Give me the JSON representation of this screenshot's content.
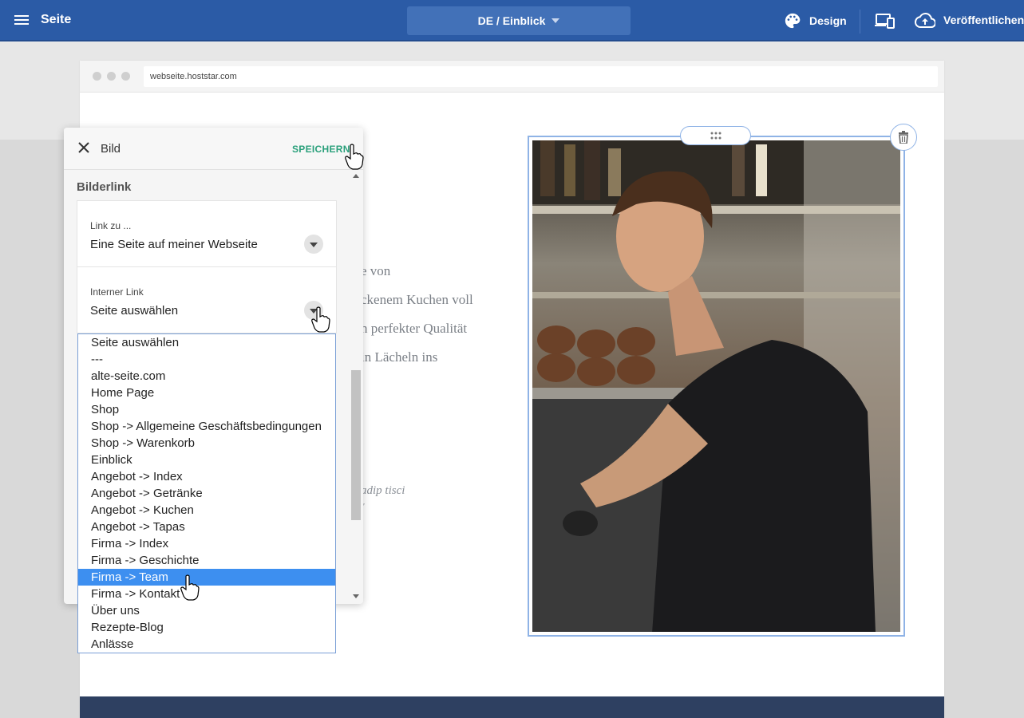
{
  "topbar": {
    "site_label": "Seite",
    "page_selector": "DE / Einblick",
    "design_label": "Design",
    "publish_label": "Veröffentlichen"
  },
  "browser": {
    "url": "webseite.hoststar.com"
  },
  "content": {
    "line1": "e von",
    "line2": "ckenem Kuchen voll",
    "line3": "n perfekter Qualität",
    "line4": "in Lächeln ins",
    "quote1": "adip tisci",
    "quote2": "\""
  },
  "panel": {
    "title": "Bild",
    "save_label": "SPEICHERN",
    "section_title": "Bilderlink",
    "link_field": {
      "label": "Link zu ...",
      "value": "Eine Seite auf meiner Webseite"
    },
    "internal_field": {
      "label": "Interner Link",
      "value": "Seite auswählen"
    }
  },
  "dropdown": {
    "options": [
      "Seite auswählen",
      "---",
      "alte-seite.com",
      "Home Page",
      "Shop",
      "Shop -> Allgemeine Geschäftsbedingungen",
      "Shop -> Warenkorb",
      "Einblick",
      "Angebot -> Index",
      "Angebot -> Getränke",
      "Angebot -> Kuchen",
      "Angebot -> Tapas",
      "Firma -> Index",
      "Firma -> Geschichte",
      "Firma -> Team",
      "Firma -> Kontakt",
      "Über uns",
      "Rezepte-Blog",
      "Anlässe"
    ],
    "selected_index": 14
  },
  "colors": {
    "topbar": "#2b5ba6",
    "save_accent": "#2aa07b",
    "selection": "#3d8ff0",
    "footer": "#2e4061"
  },
  "icons": {
    "menu": "hamburger-icon",
    "design": "palette-icon",
    "device": "devices-icon",
    "publish": "cloud-upload-icon",
    "close": "close-icon",
    "trash": "trash-icon",
    "drag": "drag-dots-icon"
  }
}
